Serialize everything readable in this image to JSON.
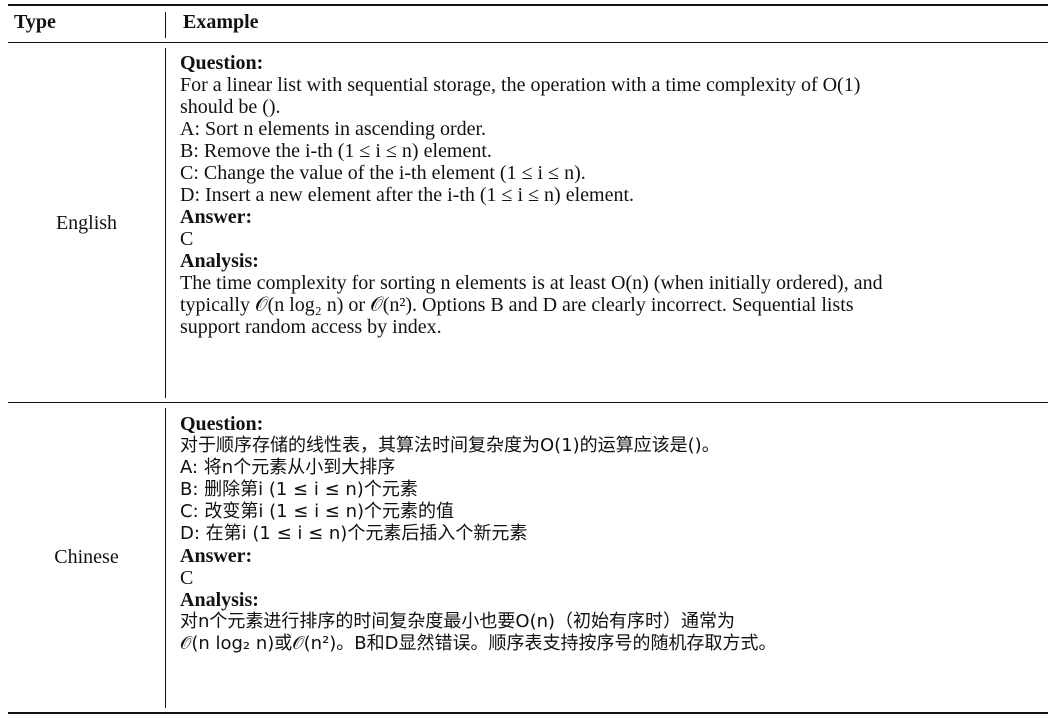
{
  "header": {
    "type": "Type",
    "example": "Example"
  },
  "rows": [
    {
      "type": "English",
      "question_label": "Question:",
      "question_lines": [
        "For a linear list with sequential storage, the operation with a time complexity of O(1)",
        "should be ()."
      ],
      "options": [
        "A: Sort n elements in ascending order.",
        "B: Remove the i-th (1 ≤ i ≤ n) element.",
        "C: Change the value of the i-th element (1 ≤ i ≤ n).",
        "D: Insert a new element after the i-th (1 ≤ i ≤ n) element."
      ],
      "answer_label": "Answer:",
      "answer": "C",
      "analysis_label": "Analysis:",
      "analysis_lines": [
        "The time complexity for sorting n elements is at least O(n) (when initially ordered), and",
        "typically 𝒪(n log₂ n) or 𝒪(n²). Options B and D are clearly incorrect. Sequential lists",
        "support random access by index."
      ]
    },
    {
      "type": "Chinese",
      "question_label": "Question:",
      "question_lines": [
        "对于顺序存储的线性表，其算法时间复杂度为O(1)的运算应该是()。"
      ],
      "options": [
        "A: 将n个元素从小到大排序",
        "B: 删除第i (1 ≤ i ≤ n)个元素",
        "C: 改变第i (1 ≤ i ≤ n)个元素的值",
        "D: 在第i (1 ≤ i ≤ n)个元素后插入个新元素"
      ],
      "answer_label": "Answer:",
      "answer": "C",
      "analysis_label": "Analysis:",
      "analysis_lines": [
        "对n个元素进行排序的时间复杂度最小也要O(n)（初始有序时）通常为",
        "𝒪(n log₂ n)或𝒪(n²)。B和D显然错误。顺序表支持按序号的随机存取方式。"
      ]
    }
  ]
}
